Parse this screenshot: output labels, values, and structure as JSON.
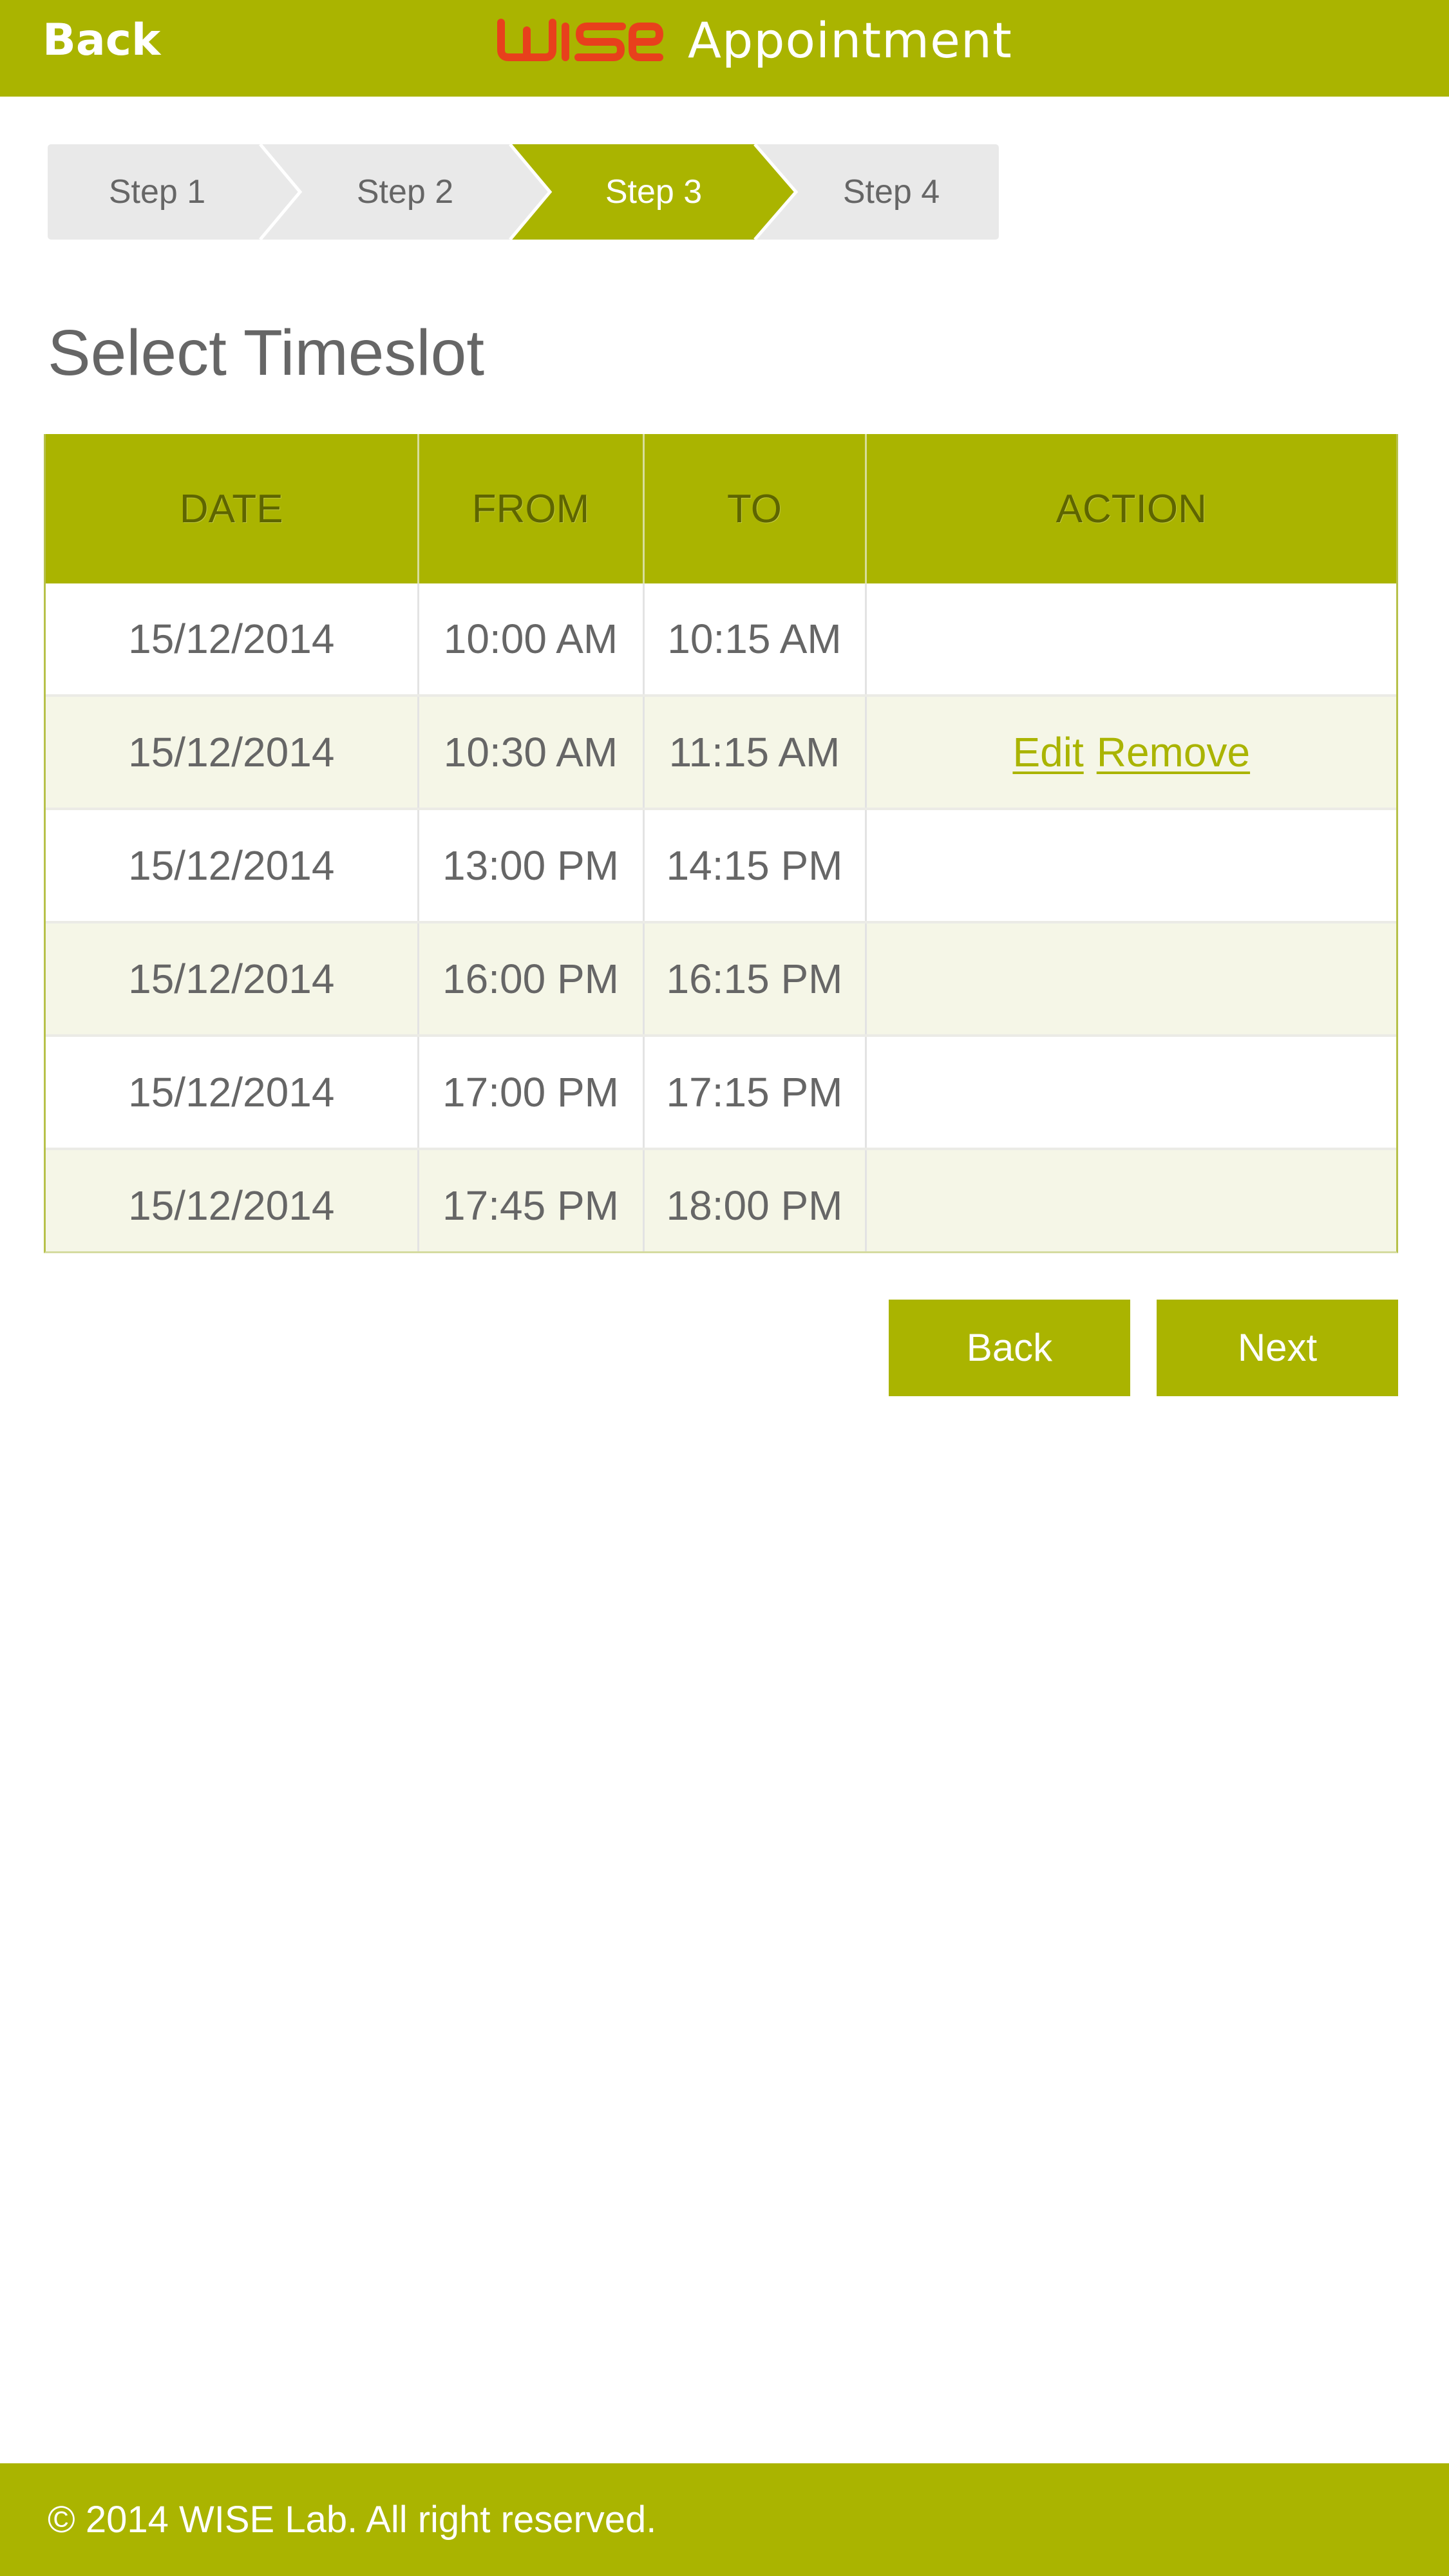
{
  "header": {
    "back_label": "Back",
    "logo_text": "WISE",
    "title": "Appointment"
  },
  "steps": [
    {
      "label": "Step 1",
      "active": false
    },
    {
      "label": "Step 2",
      "active": false
    },
    {
      "label": "Step 3",
      "active": true
    },
    {
      "label": "Step 4",
      "active": false
    }
  ],
  "page_title": "Select Timeslot",
  "table": {
    "columns": [
      "DATE",
      "FROM",
      "TO",
      "ACTION"
    ],
    "rows": [
      {
        "date": "15/12/2014",
        "from": "10:00 AM",
        "to": "10:15 AM"
      },
      {
        "date": "15/12/2014",
        "from": "10:30 AM",
        "to": "11:15 AM",
        "edit": "Edit",
        "remove": "Remove"
      },
      {
        "date": "15/12/2014",
        "from": "13:00 PM",
        "to": "14:15 PM"
      },
      {
        "date": "15/12/2014",
        "from": "16:00 PM",
        "to": "16:15 PM"
      },
      {
        "date": "15/12/2014",
        "from": "17:00 PM",
        "to": "17:15 PM"
      },
      {
        "date": "15/12/2014",
        "from": "17:45 PM",
        "to": "18:00 PM"
      }
    ]
  },
  "buttons": {
    "back_label": "Back",
    "next_label": "Next"
  },
  "footer": {
    "text": "© 2014 WISE Lab. All right reserved."
  },
  "colors": {
    "brand": "#aab400",
    "logo": "#e8401c",
    "step_inactive": "#e9e9e9",
    "row_alt": "#f5f6e7",
    "text": "#666666"
  }
}
